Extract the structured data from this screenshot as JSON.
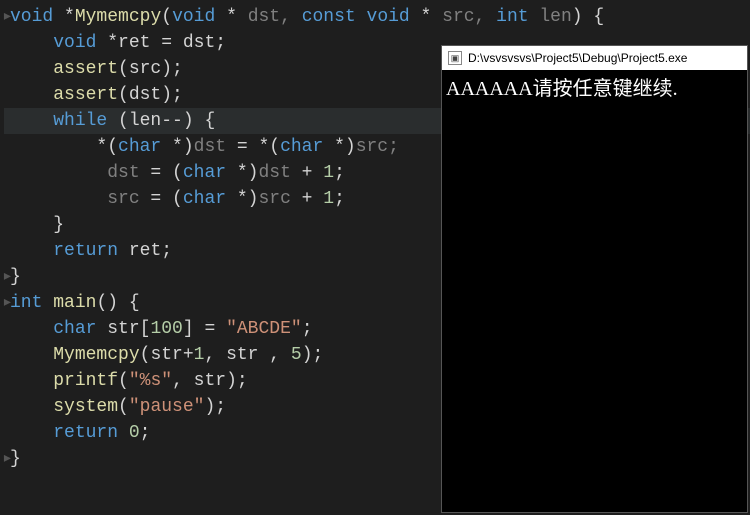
{
  "code": {
    "l1": {
      "p1": "void ",
      "p2": "*",
      "p3": "Mymemcpy",
      "p4": "(",
      "p5": "void ",
      "p6": "* ",
      "p7": "dst, ",
      "p8": "const ",
      "p9": "void ",
      "p10": "* ",
      "p11": "src, ",
      "p12": "int ",
      "p13": "len",
      "p14": ") {"
    },
    "l2": {
      "p1": "    ",
      "p2": "void ",
      "p3": "*",
      "p4": "ret",
      "p5": " = ",
      "p6": "dst;"
    },
    "l3": {
      "p1": "    ",
      "p2": "assert",
      "p3": "(src);"
    },
    "l4": {
      "p1": "    ",
      "p2": "assert",
      "p3": "(dst);"
    },
    "l5": {
      "p1": "    ",
      "p2": "while ",
      "p3": "(len--) {"
    },
    "l6": {
      "p1": "        *(",
      "p2": "char ",
      "p3": "*)",
      "p4": "dst",
      "p5": " = *(",
      "p6": "char ",
      "p7": "*)",
      "p8": "src;"
    },
    "l7": {
      "p1": "         ",
      "p2": "dst",
      "p3": " = (",
      "p4": "char ",
      "p5": "*)",
      "p6": "dst",
      "p7": " + ",
      "p8": "1",
      "p9": ";"
    },
    "l8": {
      "p1": "         ",
      "p2": "src",
      "p3": " = (",
      "p4": "char ",
      "p5": "*)",
      "p6": "src",
      "p7": " + ",
      "p8": "1",
      "p9": ";"
    },
    "l9": {
      "p1": "    }"
    },
    "l10": {
      "p1": "    ",
      "p2": "return ",
      "p3": "ret;"
    },
    "l11": {
      "p1": "}"
    },
    "l12": {
      "p1": "int ",
      "p2": "main",
      "p3": "() {"
    },
    "l13": {
      "p1": "    ",
      "p2": "char ",
      "p3": "str",
      "p4": "[",
      "p5": "100",
      "p6": "] = ",
      "p7": "\"ABCDE\"",
      "p8": ";"
    },
    "l14": {
      "p1": "    ",
      "p2": "Mymemcpy",
      "p3": "(str+",
      "p4": "1",
      "p5": ", str , ",
      "p6": "5",
      "p7": ");"
    },
    "l15": {
      "p1": "    ",
      "p2": "printf",
      "p3": "(",
      "p4": "\"%s\"",
      "p5": ", str);"
    },
    "l16": {
      "p1": "    ",
      "p2": "system",
      "p3": "(",
      "p4": "\"pause\"",
      "p5": ");"
    },
    "l17": {
      "p1": "    ",
      "p2": "return ",
      "p3": "0",
      "p4": ";"
    },
    "l18": {
      "p1": "}"
    }
  },
  "console": {
    "title": "D:\\vsvsvsvs\\Project5\\Debug\\Project5.exe",
    "output": "AAAAAA请按任意键继续."
  }
}
